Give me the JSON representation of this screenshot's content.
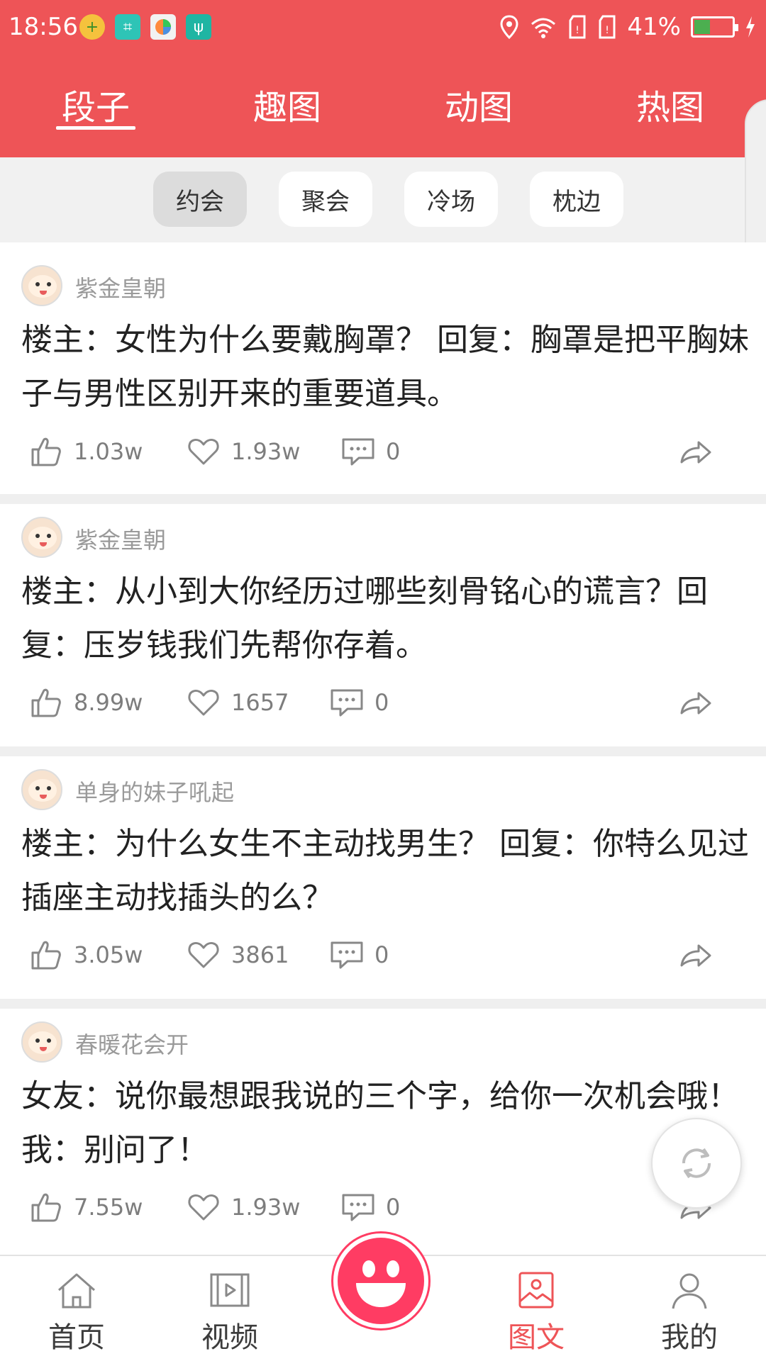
{
  "status_bar": {
    "time": "18:56",
    "battery_percent": "41%",
    "battery_level": 0.41
  },
  "top_tabs": [
    {
      "label": "段子",
      "active": true
    },
    {
      "label": "趣图",
      "active": false
    },
    {
      "label": "动图",
      "active": false
    },
    {
      "label": "热图",
      "active": false
    }
  ],
  "sub_tabs": [
    {
      "label": "约会",
      "active": true
    },
    {
      "label": "聚会",
      "active": false
    },
    {
      "label": "冷场",
      "active": false
    },
    {
      "label": "枕边",
      "active": false
    }
  ],
  "posts": [
    {
      "author": "紫金皇朝",
      "content": "楼主：女性为什么要戴胸罩？ 回复：胸罩是把平胸妹子与男性区别开来的重要道具。",
      "likes": "1.03w",
      "favorites": "1.93w",
      "comments": "0"
    },
    {
      "author": "紫金皇朝",
      "content": "楼主：从小到大你经历过哪些刻骨铭心的谎言？回复：压岁钱我们先帮你存着。",
      "likes": "8.99w",
      "favorites": "1657",
      "comments": "0"
    },
    {
      "author": "单身的妹子吼起",
      "content": "楼主：为什么女生不主动找男生？ 回复：你特么见过插座主动找插头的么？",
      "likes": "3.05w",
      "favorites": "3861",
      "comments": "0"
    },
    {
      "author": "春暖花会开",
      "content": "女友：说你最想跟我说的三个字，给你一次机会哦！ 我：别问了！",
      "likes": "7.55w",
      "favorites": "1.93w",
      "comments": "0"
    }
  ],
  "bottom_nav": [
    {
      "label": "首页",
      "icon": "home-icon",
      "active": false
    },
    {
      "label": "视频",
      "icon": "video-icon",
      "active": false
    },
    {
      "label": "图文",
      "icon": "image-text-icon",
      "active": true
    },
    {
      "label": "我的",
      "icon": "profile-icon",
      "active": false
    }
  ],
  "colors": {
    "primary": "#ee5457",
    "center_button": "#ff3c63",
    "battery_fill": "#4caf50"
  }
}
